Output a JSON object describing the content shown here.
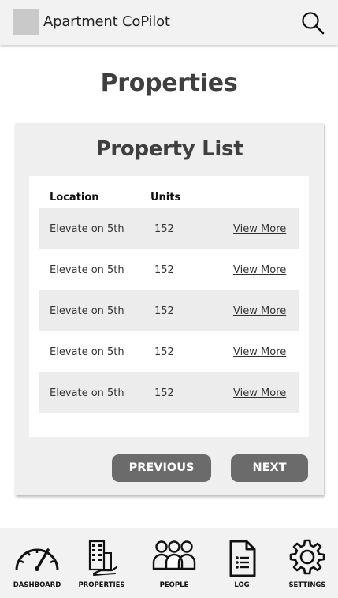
{
  "header": {
    "app_title": "Apartment CoPilot",
    "search_icon": "search-icon"
  },
  "page_title": "Properties",
  "property_list": {
    "title": "Property List",
    "columns": {
      "location": "Location",
      "units": "Units"
    },
    "rows": [
      {
        "location": "Elevate on 5th",
        "units": "152",
        "link": "View More"
      },
      {
        "location": "Elevate on 5th",
        "units": "152",
        "link": "View More"
      },
      {
        "location": "Elevate on 5th",
        "units": "152",
        "link": "View More"
      },
      {
        "location": "Elevate on 5th",
        "units": "152",
        "link": "View More"
      },
      {
        "location": "Elevate on 5th",
        "units": "152",
        "link": "View More"
      }
    ]
  },
  "pagination": {
    "previous": "PREVIOUS",
    "next": "NEXT"
  },
  "bottom_nav": [
    {
      "label": "DASHBOARD",
      "icon": "speedometer-icon"
    },
    {
      "label": "PROPERTIES",
      "icon": "building-icon"
    },
    {
      "label": "PEOPLE",
      "icon": "people-icon"
    },
    {
      "label": "LOG",
      "icon": "document-list-icon"
    },
    {
      "label": "SETTINGS",
      "icon": "gear-icon"
    }
  ],
  "colors": {
    "header_bg": "#f2f2f2",
    "card_bg": "#efefef",
    "button_bg": "#6b6b6b",
    "row_shade": "#ececec"
  }
}
